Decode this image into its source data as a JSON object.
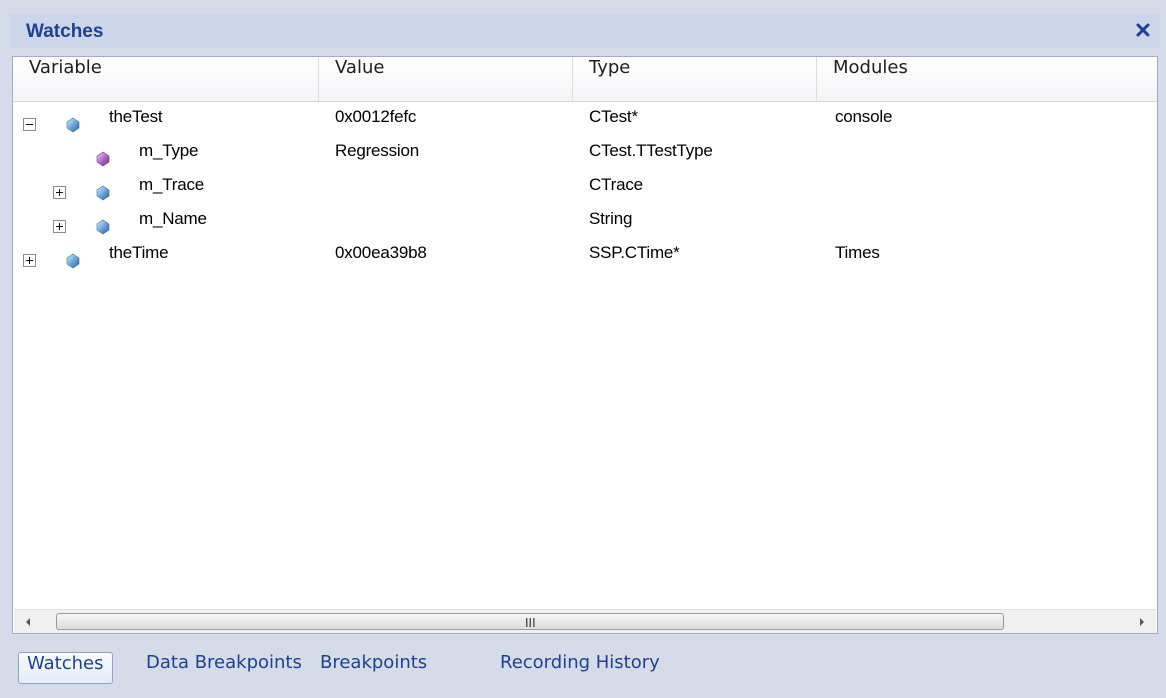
{
  "window": {
    "title": "Watches",
    "close_icon": "close-icon"
  },
  "columns": [
    "Variable",
    "Value",
    "Type",
    "Modules"
  ],
  "rows": [
    {
      "name": "theTest",
      "value": "0x0012fefc",
      "type": "CTest*",
      "module": "console",
      "toggle": "minus",
      "icon": "blue-gem-icon"
    },
    {
      "name": "m_Type",
      "value": "Regression",
      "type": "CTest.TTestType",
      "module": "",
      "toggle": "none",
      "icon": "purple-gem-icon"
    },
    {
      "name": "m_Trace",
      "value": "",
      "type": "CTrace",
      "module": "",
      "toggle": "plus",
      "icon": "blue-gem-icon"
    },
    {
      "name": "m_Name",
      "value": "",
      "type": "String",
      "module": "",
      "toggle": "plus",
      "icon": "blue-gem-icon"
    },
    {
      "name": "theTime",
      "value": "0x00ea39b8",
      "type": "SSP.CTime*",
      "module": "Times",
      "toggle": "plus",
      "icon": "blue-gem-icon"
    }
  ],
  "scrollbar": {
    "grip": "III"
  },
  "tabs": [
    {
      "label": "Watches",
      "active": true
    },
    {
      "label": "Data Breakpoints",
      "active": false
    },
    {
      "label": "Breakpoints",
      "active": false
    },
    {
      "label": "Recording History",
      "active": false
    }
  ],
  "colors": {
    "accent": "#1f3f8f",
    "blue_gem": "#6fa8dc",
    "purple_gem": "#b56bc9"
  }
}
